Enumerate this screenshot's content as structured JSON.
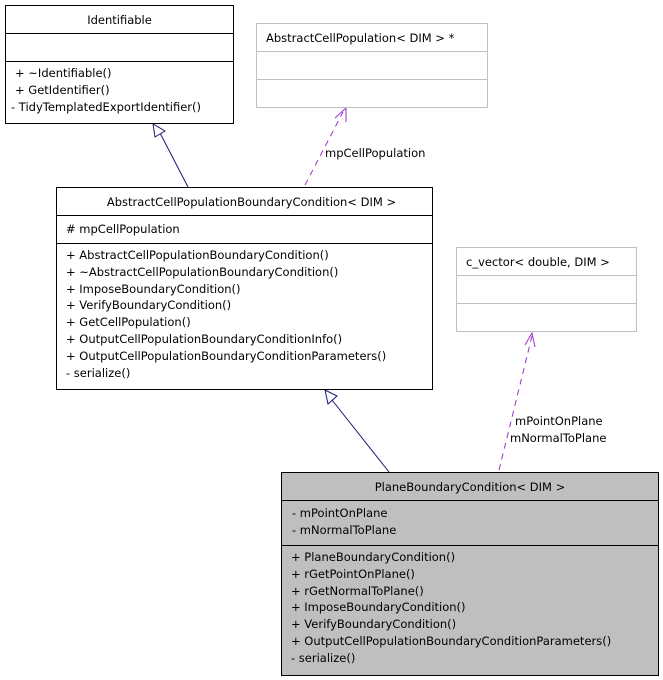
{
  "diagram": {
    "type": "uml-class-collaboration",
    "classes": {
      "identifiable": {
        "name": "Identifiable",
        "attributes": [],
        "methods": [
          "+ ~Identifiable()",
          "+ GetIdentifier()",
          "- TidyTemplatedExportIdentifier()"
        ]
      },
      "abstract_cell_population": {
        "name": "AbstractCellPopulation< DIM > *",
        "attributes": [],
        "methods": []
      },
      "abstract_boundary_condition": {
        "name": "AbstractCellPopulationBoundaryCondition< DIM >",
        "attributes": [
          "# mpCellPopulation"
        ],
        "methods": [
          "+ AbstractCellPopulationBoundaryCondition()",
          "+ ~AbstractCellPopulationBoundaryCondition()",
          "+ ImposeBoundaryCondition()",
          "+ VerifyBoundaryCondition()",
          "+ GetCellPopulation()",
          "+ OutputCellPopulationBoundaryConditionInfo()",
          "+ OutputCellPopulationBoundaryConditionParameters()",
          "- serialize()"
        ]
      },
      "c_vector": {
        "name": "c_vector< double, DIM >",
        "attributes": [],
        "methods": []
      },
      "plane_boundary_condition": {
        "name": "PlaneBoundaryCondition< DIM >",
        "attributes": [
          "- mPointOnPlane",
          "- mNormalToPlane"
        ],
        "methods": [
          "+ PlaneBoundaryCondition()",
          "+ rGetPointOnPlane()",
          "+ rGetNormalToPlane()",
          "+ ImposeBoundaryCondition()",
          "+ VerifyBoundaryCondition()",
          "+ OutputCellPopulationBoundaryConditionParameters()",
          "- serialize()"
        ]
      }
    },
    "edges": {
      "inherit_identifiable": {
        "from": "abstract_boundary_condition",
        "to": "identifiable",
        "kind": "inheritance"
      },
      "usage_cell_population": {
        "from": "abstract_boundary_condition",
        "to": "abstract_cell_population",
        "kind": "usage",
        "label": "mpCellPopulation"
      },
      "inherit_abstract_bc": {
        "from": "plane_boundary_condition",
        "to": "abstract_boundary_condition",
        "kind": "inheritance"
      },
      "usage_c_vector": {
        "from": "plane_boundary_condition",
        "to": "c_vector",
        "kind": "usage",
        "label_lines": [
          "mPointOnPlane",
          "mNormalToPlane"
        ]
      }
    },
    "colors": {
      "inheritance_edge": "#191970",
      "usage_edge": "#9a32cd",
      "focus_fill": "#bfbfbf",
      "external_border": "#bfbfbf"
    }
  }
}
